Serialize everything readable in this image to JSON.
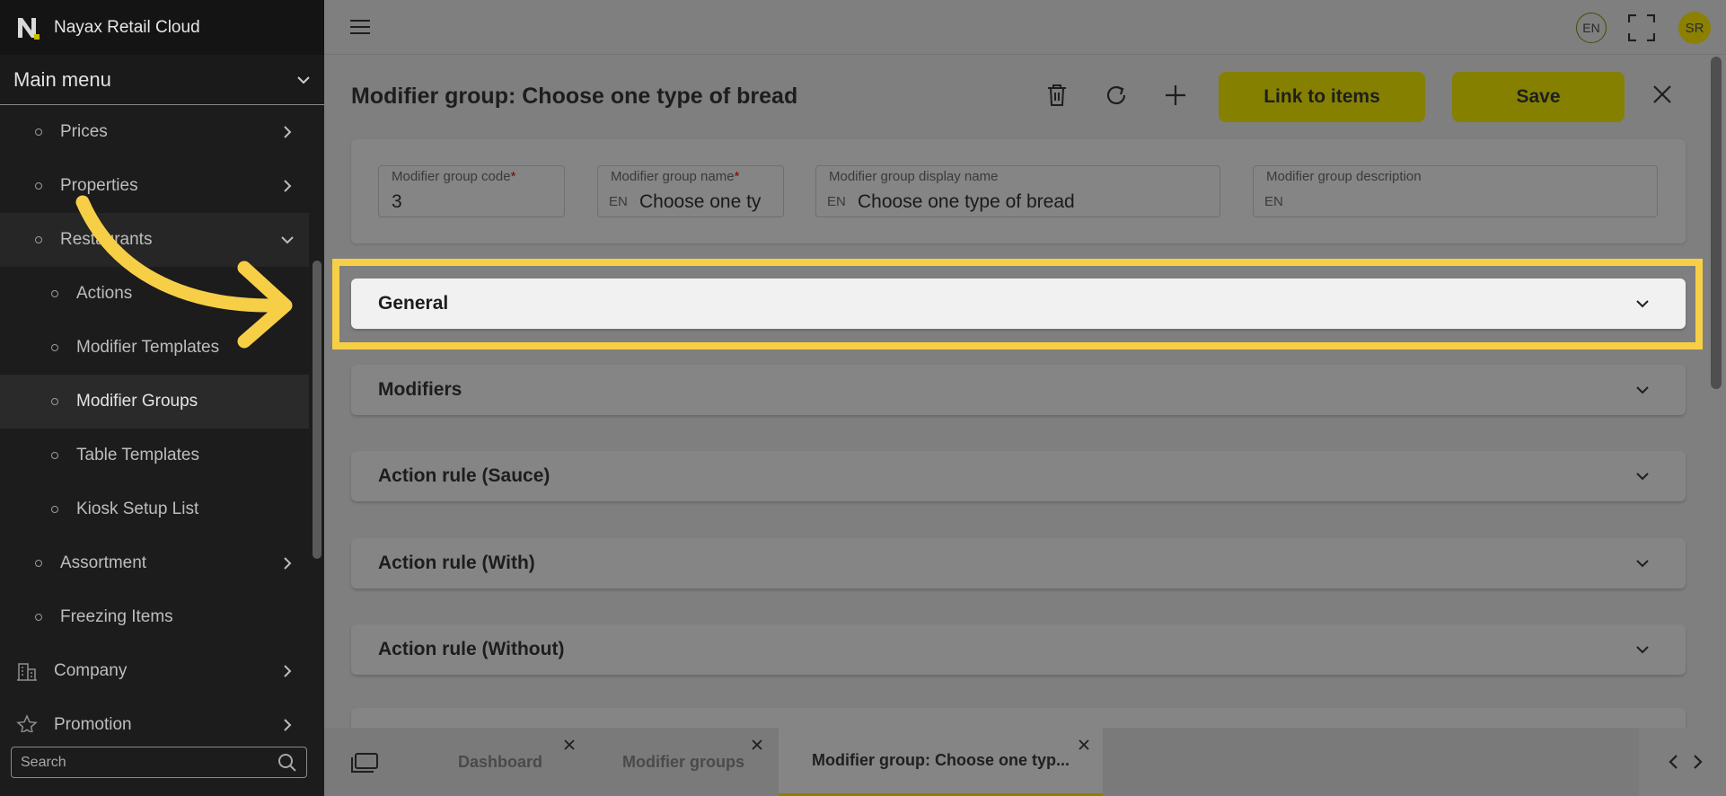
{
  "brand": {
    "title": "Nayax Retail Cloud"
  },
  "sidebar": {
    "main_menu": "Main menu",
    "items": [
      {
        "label": "Prices",
        "level": 1,
        "chevron": "right"
      },
      {
        "label": "Properties",
        "level": 1,
        "chevron": "right"
      },
      {
        "label": "Restaurants",
        "level": 1,
        "chevron": "down"
      },
      {
        "label": "Actions",
        "level": 2
      },
      {
        "label": "Modifier Templates",
        "level": 2
      },
      {
        "label": "Modifier Groups",
        "level": 2,
        "active": true
      },
      {
        "label": "Table Templates",
        "level": 2
      },
      {
        "label": "Kiosk Setup List",
        "level": 2
      },
      {
        "label": "Assortment",
        "level": 1,
        "chevron": "right"
      },
      {
        "label": "Freezing Items",
        "level": 1
      },
      {
        "label": "Company",
        "level": 0,
        "icon": "building-icon",
        "chevron": "right"
      },
      {
        "label": "Promotion",
        "level": 0,
        "icon": "star-icon",
        "chevron": "right"
      }
    ],
    "search": {
      "placeholder": "Search"
    }
  },
  "topbar": {
    "language": "EN",
    "avatar_initials": "SR"
  },
  "main": {
    "title": "Modifier group: Choose one type of bread",
    "buttons": {
      "link_to_items": "Link to items",
      "save": "Save"
    },
    "fields": {
      "code": {
        "label": "Modifier group code",
        "required": "*",
        "value": "3"
      },
      "name": {
        "label": "Modifier group name",
        "required": "*",
        "lang": "EN",
        "value": "Choose one ty"
      },
      "display_name": {
        "label": "Modifier group display name",
        "lang": "EN",
        "value": "Choose one type of bread"
      },
      "description": {
        "label": "Modifier group description",
        "lang": "EN",
        "value": ""
      }
    },
    "sections": [
      {
        "title": "General",
        "highlighted": true
      },
      {
        "title": "Modifiers"
      },
      {
        "title": "Action rule (Sauce)"
      },
      {
        "title": "Action rule (With)"
      },
      {
        "title": "Action rule (Without)"
      }
    ]
  },
  "tabs": [
    {
      "label": "Dashboard"
    },
    {
      "label": "Modifier groups"
    },
    {
      "label": "Modifier group: Choose one typ...",
      "active": true
    }
  ],
  "colors": {
    "accent": "#f7cf47",
    "brand_yellow": "#d4c700"
  }
}
